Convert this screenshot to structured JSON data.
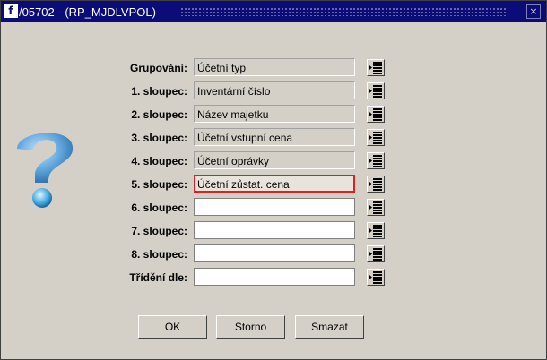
{
  "window": {
    "app_icon": "f",
    "title": "/05702 - (RP_MJDLVPOL)",
    "close_icon": "close-icon"
  },
  "form": {
    "rows": [
      {
        "label": "Grupování:",
        "value": "Účetní typ"
      },
      {
        "label": "1. sloupec:",
        "value": "Inventární číslo"
      },
      {
        "label": "2. sloupec:",
        "value": "Název majetku"
      },
      {
        "label": "3. sloupec:",
        "value": "Účetní vstupní cena"
      },
      {
        "label": "4. sloupec:",
        "value": "Účetní oprávky"
      },
      {
        "label": "5. sloupec:",
        "value": "Účetní zůstat. cena"
      },
      {
        "label": "6. sloupec:",
        "value": ""
      },
      {
        "label": "7. sloupec:",
        "value": ""
      },
      {
        "label": "8. sloupec:",
        "value": ""
      },
      {
        "label": "Třídění dle:",
        "value": ""
      }
    ]
  },
  "buttons": {
    "ok": "OK",
    "cancel": "Storno",
    "delete": "Smazat"
  },
  "colors": {
    "titlebar": "#0c0c78",
    "dialog_bg": "#d4d0c8",
    "active_border": "#e02020",
    "question_icon": "#5aa0d8"
  }
}
